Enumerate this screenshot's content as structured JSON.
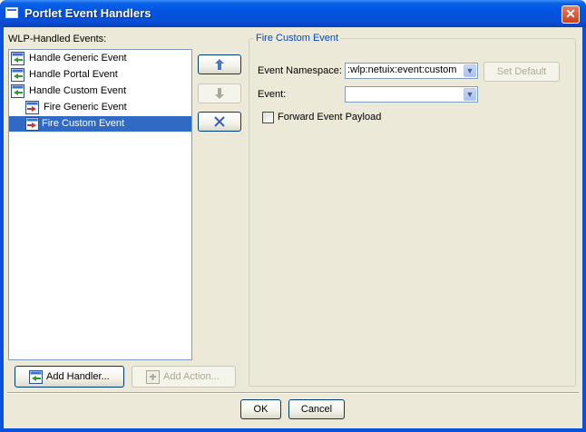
{
  "window": {
    "title": "Portlet Event Handlers"
  },
  "left_panel": {
    "label": "WLP-Handled Events:",
    "items": [
      {
        "label": "Handle Generic Event",
        "level": 0,
        "selected": false,
        "icon": "handler-icon"
      },
      {
        "label": "Handle Portal Event",
        "level": 0,
        "selected": false,
        "icon": "handler-icon"
      },
      {
        "label": "Handle Custom Event",
        "level": 0,
        "selected": false,
        "icon": "handler-icon"
      },
      {
        "label": "Fire Generic Event",
        "level": 1,
        "selected": false,
        "icon": "fire-event-icon"
      },
      {
        "label": "Fire Custom Event",
        "level": 1,
        "selected": true,
        "icon": "fire-event-icon"
      }
    ]
  },
  "reorder_buttons": {
    "up_icon": "arrow-up-icon",
    "down_icon": "arrow-down-icon",
    "delete_icon": "delete-x-icon"
  },
  "buttons": {
    "add_handler": "Add Handler...",
    "add_action": "Add Action..."
  },
  "detail": {
    "legend": "Fire Custom Event",
    "namespace_label": "Event Namespace:",
    "namespace_value": ":wlp:netuix:event:custom",
    "set_default": "Set Default",
    "event_label": "Event:",
    "event_value": "",
    "forward_label": "Forward Event Payload",
    "forward_checked": false
  },
  "footer": {
    "ok": "OK",
    "cancel": "Cancel"
  },
  "colors": {
    "title_bar": "#0054e3",
    "selection": "#316ac5",
    "dialog_bg": "#ece9d8",
    "legend": "#0046d5"
  }
}
